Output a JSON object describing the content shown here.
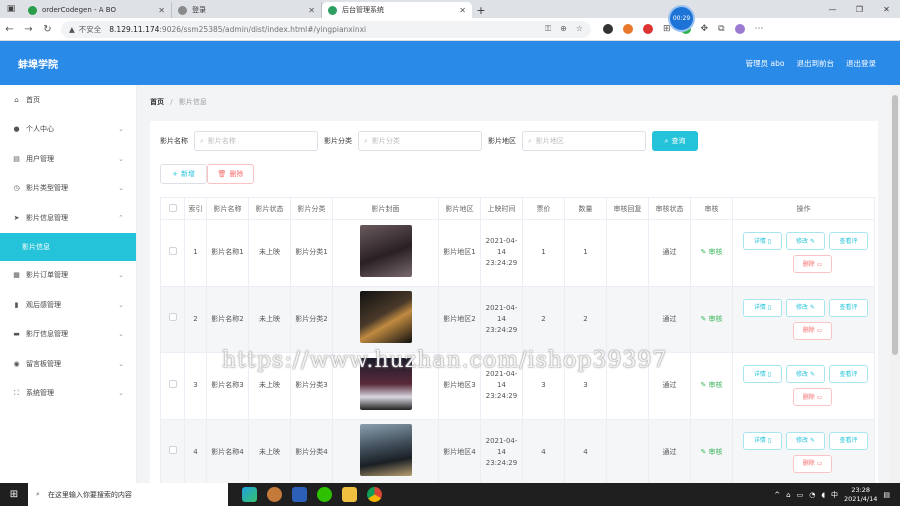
{
  "browser": {
    "tabs": [
      {
        "title": "orderCodegen - A BO",
        "color": "#2a9d4b"
      },
      {
        "title": "登录",
        "color": "#8a8a8a"
      },
      {
        "title": "后台管理系统",
        "color": "#2e9e62"
      }
    ],
    "timer": "00:29",
    "url_prefix": "不安全",
    "url_host": "8.129.11.174",
    "url_path": ":9026/ssm25385/admin/dist/index.html#/yingpianxinxi"
  },
  "header": {
    "logo": "蚌埠学院",
    "admin": "管理员 abo",
    "back_front": "退出到前台",
    "logout": "退出登录"
  },
  "sidebar": {
    "items": [
      {
        "label": "首页",
        "icon": "home-icon",
        "chev": false
      },
      {
        "label": "个人中心",
        "icon": "user-icon",
        "chev": true
      },
      {
        "label": "用户管理",
        "icon": "list-icon",
        "chev": true
      },
      {
        "label": "影片类型管理",
        "icon": "clock-icon",
        "chev": true
      },
      {
        "label": "影片信息管理",
        "icon": "send-icon",
        "chev": true
      }
    ],
    "active_sub": "影片信息",
    "items_after": [
      {
        "label": "影片订单管理",
        "icon": "film-icon",
        "chev": true
      },
      {
        "label": "观后感管理",
        "icon": "bar-chart-icon",
        "chev": true
      },
      {
        "label": "影厅信息管理",
        "icon": "chat-icon",
        "chev": true
      },
      {
        "label": "留言板管理",
        "icon": "pin-icon",
        "chev": true
      },
      {
        "label": "系统管理",
        "icon": "expand-icon",
        "chev": true
      }
    ]
  },
  "breadcrumb": {
    "home": "首页",
    "sep": "/",
    "current": "影片信息"
  },
  "search": {
    "name_label": "影片名称",
    "name_placeholder": "影片名称",
    "type_label": "影片分类",
    "type_placeholder": "影片分类",
    "region_label": "影片地区",
    "region_placeholder": "影片地区",
    "query_button": "查询"
  },
  "actions": {
    "add": "新增",
    "delete": "删除"
  },
  "table": {
    "columns": [
      "",
      "索引",
      "影片名称",
      "影片状态",
      "影片分类",
      "影片封面",
      "影片地区",
      "上映时间",
      "票价",
      "数量",
      "审核回复",
      "审核状态",
      "审核",
      "操作"
    ],
    "rows": [
      {
        "index": "1",
        "name": "影片名称1",
        "status": "未上映",
        "type": "影片分类1",
        "poster_color": "#3a2f33",
        "region": "影片地区1",
        "time": "2021-04-14 23:24:29",
        "price": "1",
        "qty": "1",
        "reply": "",
        "audit_status": "通过",
        "audit": "审核"
      },
      {
        "index": "2",
        "name": "影片名称2",
        "status": "未上映",
        "type": "影片分类2",
        "poster_color": "#1f1a1a",
        "region": "影片地区2",
        "time": "2021-04-14 23:24:29",
        "price": "2",
        "qty": "2",
        "reply": "",
        "audit_status": "通过",
        "audit": "审核"
      },
      {
        "index": "3",
        "name": "影片名称3",
        "status": "未上映",
        "type": "影片分类3",
        "poster_color": "#2c2630",
        "region": "影片地区3",
        "time": "2021-04-14 23:24:29",
        "price": "3",
        "qty": "3",
        "reply": "",
        "audit_status": "通过",
        "audit": "审核"
      },
      {
        "index": "4",
        "name": "影片名称4",
        "status": "未上映",
        "type": "影片分类4",
        "poster_color": "#3d4a55",
        "region": "影片地区4",
        "time": "2021-04-14 23:24:29",
        "price": "4",
        "qty": "4",
        "reply": "",
        "audit_status": "通过",
        "audit": "审核"
      }
    ],
    "op_labels": {
      "detail": "详情",
      "edit": "修改",
      "review": "查看评",
      "delete": "删除"
    }
  },
  "watermark": "https://www.huzhan.com/ishop39397",
  "taskbar": {
    "search_placeholder": "在这里输入你要搜索的内容",
    "time": "23:28",
    "date": "2021/4/14"
  }
}
